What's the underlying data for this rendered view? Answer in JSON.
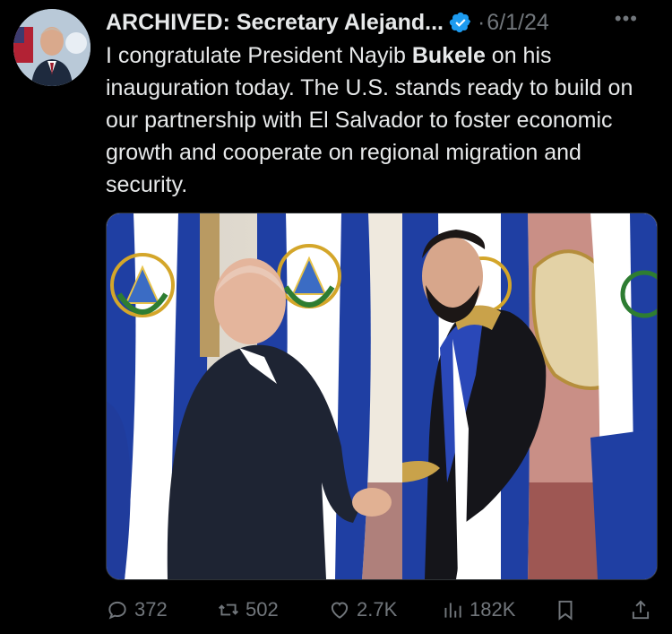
{
  "tweet": {
    "author_display": "ARCHIVED: Secretary Alejand...",
    "date": "6/1/24",
    "separator": "·",
    "more": "•••",
    "text_parts": {
      "before": "I congratulate President Nayib ",
      "bold": "Bukele",
      "after": " on his inauguration today. The U.S. stands ready to build on our partnership with El Salvador to foster economic growth and cooperate on regional migration and security."
    },
    "colors": {
      "verified": "#1d9bf0",
      "muted": "#71767b",
      "text": "#e7e9ea"
    }
  },
  "actions": {
    "replies": "372",
    "reposts": "502",
    "likes": "2.7K",
    "views": "182K"
  },
  "icons": {
    "reply": "speech-bubble-icon",
    "repost": "repost-arrows-icon",
    "like": "heart-icon",
    "views": "bar-chart-icon",
    "bookmark": "bookmark-icon",
    "share": "share-icon",
    "verified": "verified-badge-icon"
  }
}
